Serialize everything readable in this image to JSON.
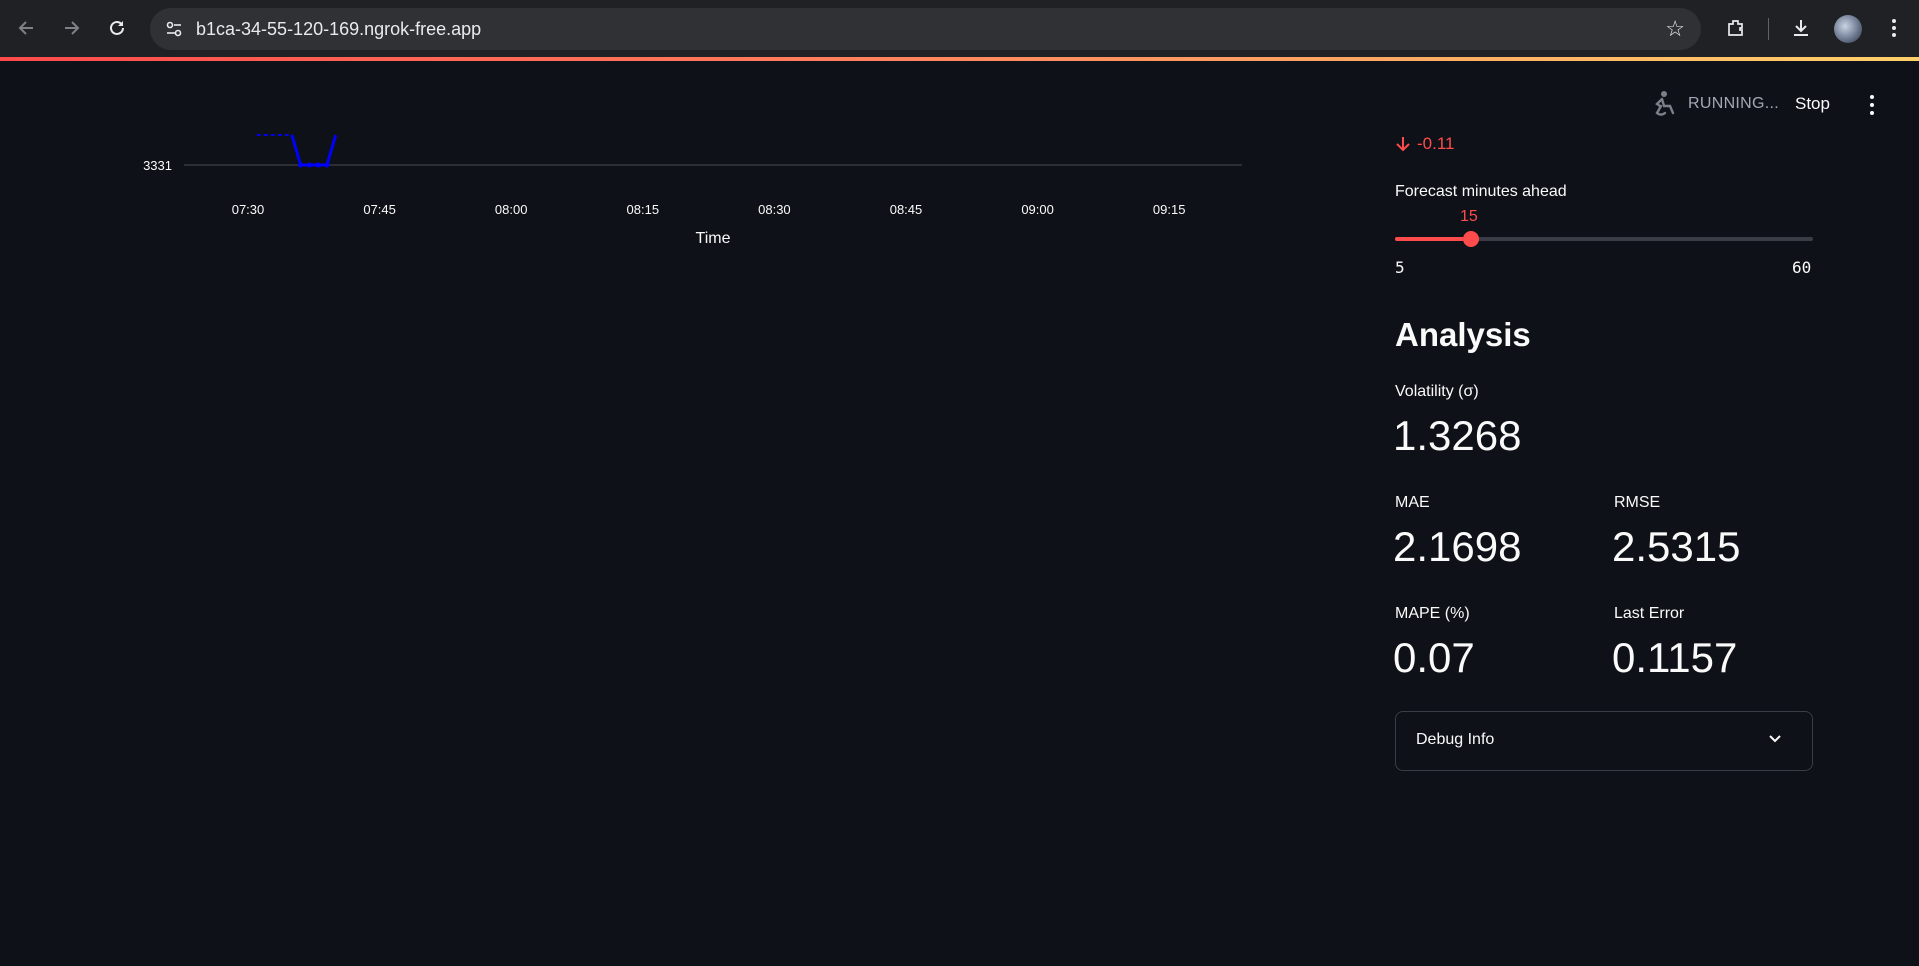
{
  "browser": {
    "url": "b1ca-34-55-120-169.ngrok-free.app"
  },
  "app_header": {
    "status_text": "RUNNING...",
    "stop_label": "Stop"
  },
  "chart_data": {
    "type": "line",
    "xlabel": "Time",
    "ylabel": "",
    "x_ticks": [
      "07:30",
      "07:45",
      "08:00",
      "08:15",
      "08:30",
      "08:45",
      "09:00",
      "09:15"
    ],
    "y_ticks": [
      "3331"
    ],
    "series": [
      {
        "style": "dashed",
        "color": "#0000ff",
        "points": [
          [
            "07:31",
            3331.5
          ],
          [
            "07:35",
            3331.5
          ]
        ]
      },
      {
        "style": "solid",
        "color": "#0000ff",
        "points": [
          [
            "07:35",
            3331.5
          ],
          [
            "07:36",
            3331
          ],
          [
            "07:37",
            3331
          ],
          [
            "07:38",
            3331
          ],
          [
            "07:39",
            3331
          ],
          [
            "07:40",
            3331.5
          ]
        ]
      }
    ]
  },
  "delta": {
    "value": "-0.11",
    "color": "#ff4b4b"
  },
  "slider": {
    "label": "Forecast minutes ahead",
    "value": "15",
    "min": "5",
    "max": "60",
    "fraction": 0.1818
  },
  "analysis": {
    "title": "Analysis",
    "volatility": {
      "label": "Volatility (σ)",
      "value": "1.3268"
    },
    "mae": {
      "label": "MAE",
      "value": "2.1698"
    },
    "rmse": {
      "label": "RMSE",
      "value": "2.5315"
    },
    "mape": {
      "label": "MAPE (%)",
      "value": "0.07"
    },
    "last_error": {
      "label": "Last Error",
      "value": "0.1157"
    }
  },
  "debug": {
    "label": "Debug Info"
  }
}
